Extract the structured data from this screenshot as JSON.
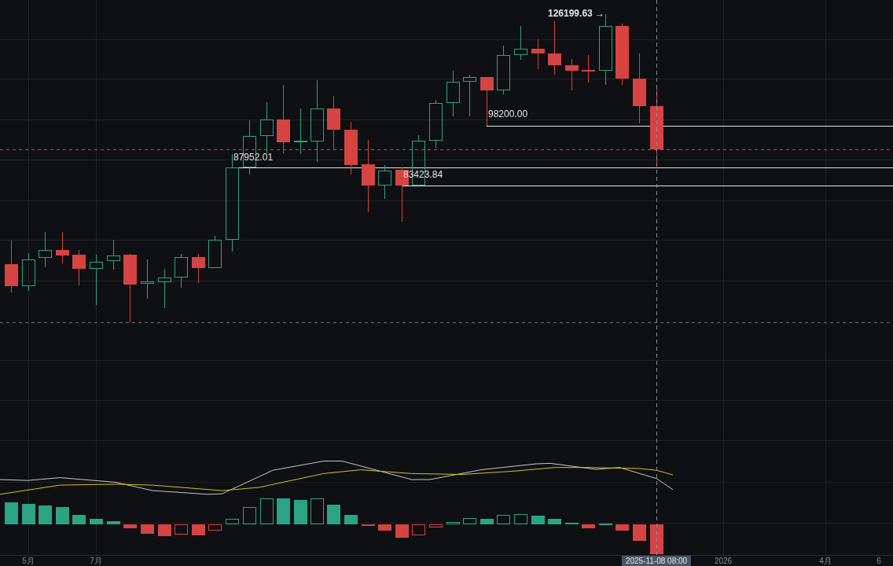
{
  "price_labels": [
    {
      "text": "126199.63 →"
    },
    {
      "text": "98200.00"
    },
    {
      "text": "87952.01"
    },
    {
      "text": "83423.84"
    }
  ],
  "crosshair_time": "2025-11-08 08:00",
  "time_axis": [
    "5月",
    "7月",
    "2026",
    "4月",
    "6"
  ]
}
